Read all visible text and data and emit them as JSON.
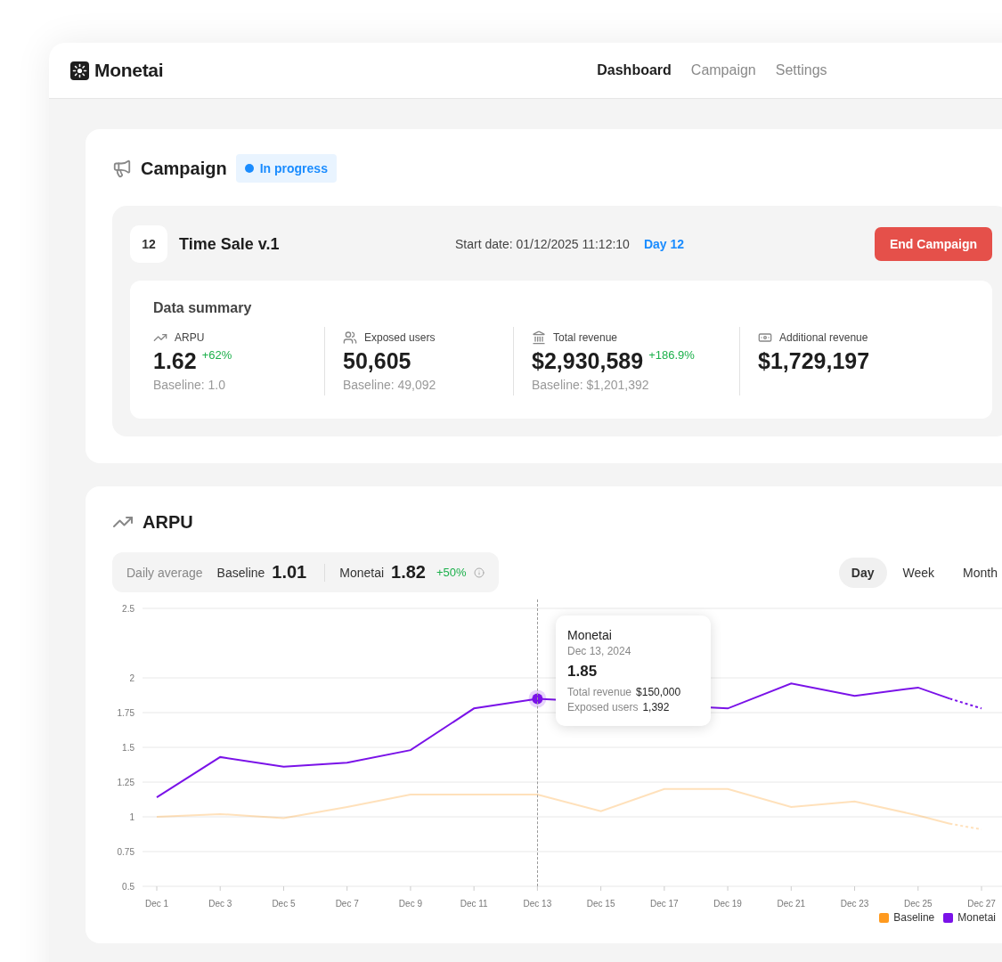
{
  "brand": {
    "name": "Monetai"
  },
  "nav": [
    {
      "label": "Dashboard",
      "selected": true
    },
    {
      "label": "Campaign",
      "selected": false
    },
    {
      "label": "Settings",
      "selected": false
    }
  ],
  "campaign": {
    "title": "Campaign",
    "status": {
      "label": "In progress",
      "color": "#1a8cff"
    },
    "number": "12",
    "name": "Time Sale v.1",
    "start_date": "Start date: 01/12/2025 11:12:10",
    "day": "Day 12",
    "end_button": "End Campaign",
    "summary": {
      "title": "Data summary",
      "metrics": [
        {
          "kind": "trend",
          "label": "ARPU",
          "value": "1.62",
          "change": "+62%",
          "baseline": "Baseline: 1.0"
        },
        {
          "kind": "users",
          "label": "Exposed users",
          "value": "50,605",
          "baseline": "Baseline: 49,092"
        },
        {
          "kind": "bank",
          "label": "Total revenue",
          "value": "$2,930,589",
          "change": "+186.9%",
          "baseline": "Baseline: $1,201,392"
        },
        {
          "kind": "money",
          "label": "Additional revenue",
          "value": "$1,729,197"
        }
      ]
    }
  },
  "arpu": {
    "title": "ARPU",
    "daily": {
      "label": "Daily average",
      "items": [
        {
          "name": "Baseline",
          "value": "1.01"
        },
        {
          "name": "Monetai",
          "value": "1.82",
          "change": "+50%"
        }
      ]
    },
    "periods": [
      {
        "label": "Day",
        "selected": true
      },
      {
        "label": "Week",
        "selected": false
      },
      {
        "label": "Month",
        "selected": false
      }
    ],
    "dashed_tail": true,
    "chart_data": {
      "type": "line",
      "categories": [
        "Dec 1",
        null,
        "Dec 3",
        null,
        "Dec 5",
        null,
        "Dec 7",
        null,
        "Dec 9",
        null,
        "Dec 11",
        null,
        "Dec 13",
        null,
        "Dec 15",
        null,
        "Dec 17",
        null,
        "Dec 19",
        null,
        "Dec 21",
        null,
        "Dec 23",
        null,
        "Dec 25",
        null,
        "Dec 27"
      ],
      "series": [
        {
          "name": "Baseline",
          "color": "#ff9a1f",
          "values": [
            1.0,
            null,
            1.02,
            null,
            0.99,
            null,
            1.07,
            null,
            1.16,
            null,
            1.16,
            null,
            1.16,
            null,
            1.04,
            null,
            1.2,
            null,
            1.2,
            null,
            1.07,
            null,
            1.11,
            null,
            1.01,
            0.95,
            0.91
          ]
        },
        {
          "name": "Monetai",
          "color": "#7a12e8",
          "values": [
            1.14,
            null,
            1.43,
            null,
            1.36,
            null,
            1.39,
            null,
            1.48,
            null,
            1.78,
            null,
            1.85,
            null,
            null,
            null,
            null,
            null,
            1.78,
            null,
            1.96,
            null,
            1.87,
            null,
            1.93,
            1.85,
            1.78
          ]
        }
      ],
      "ylim": [
        0.5,
        2.5
      ],
      "yticks": [
        0.5,
        0.75,
        1,
        1.25,
        1.5,
        1.75,
        2,
        2.5
      ],
      "grid": true
    },
    "tooltip": {
      "title": "Monetai",
      "date": "Dec 13, 2024",
      "value": "1.85",
      "rows": [
        {
          "label": "Total revenue",
          "value": "$150,000"
        },
        {
          "label": "Exposed users",
          "value": "1,392"
        }
      ]
    }
  }
}
